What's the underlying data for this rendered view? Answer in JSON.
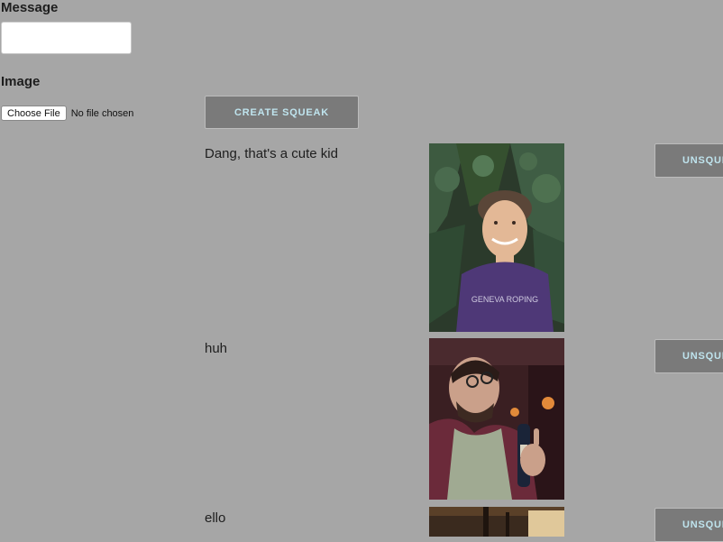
{
  "form": {
    "message_label": "Message",
    "message_value": "",
    "image_label": "Image",
    "choose_file_label": "Choose File",
    "file_status": "No file chosen",
    "create_button": "CREATE SQUEAK"
  },
  "squeaks": [
    {
      "message": "Dang, that's a cute kid",
      "button": "UNSQUEAK",
      "photo_icon": "boy-photo"
    },
    {
      "message": "huh",
      "button": "UNSQUEAK",
      "photo_icon": "man-with-bottle-photo"
    },
    {
      "message": "ello",
      "button": "UNSQUEAK",
      "photo_icon": "room-photo"
    }
  ],
  "colors": {
    "page_bg": "#a6a6a6",
    "button_bg": "#7a7a7a",
    "button_text": "#bfe4ee"
  }
}
